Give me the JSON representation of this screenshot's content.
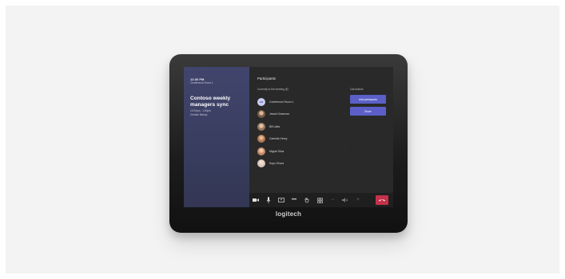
{
  "meeting": {
    "time": "12:30 PM",
    "room": "Conference Room 1",
    "title": "Contoso weekly managers sync",
    "time_range": "12:00pm - 1:00pm",
    "organizer": "Christie Bishop"
  },
  "participants_panel": {
    "title": "Participants",
    "subheading": "Currently in the meeting (6)",
    "call_actions_label": "Call actions",
    "primary_action": "Add participants",
    "secondary_action": "Share",
    "items": [
      {
        "name": "Conference Room 1",
        "initials": "CR",
        "color": "#c9ccf0",
        "avatar_type": "initials",
        "muted": false
      },
      {
        "name": "Jessie Dinsmore",
        "color": "#7a5a47",
        "avatar_type": "photo",
        "muted": true
      },
      {
        "name": "Bill Latta",
        "color": "#9a7a60",
        "avatar_type": "photo",
        "muted": false
      },
      {
        "name": "Camelia Henry",
        "color": "#b07a52",
        "avatar_type": "photo",
        "muted": false
      },
      {
        "name": "Miguel Silva",
        "color": "#c48a6a",
        "avatar_type": "photo",
        "muted": true
      },
      {
        "name": "Kayo Ohara",
        "color": "#d9c7bc",
        "avatar_type": "photo",
        "muted": false
      }
    ]
  },
  "toolbar": {
    "icons": [
      "camera-icon",
      "microphone-icon",
      "share-screen-icon",
      "more-options-icon",
      "raise-hand-icon",
      "layout-icon",
      "volume-down-icon",
      "volume-mute-icon",
      "volume-up-icon"
    ],
    "end_call_color": "#c4314b"
  },
  "brand": {
    "logo": "logitech"
  },
  "colors": {
    "accent": "#5b5fc7",
    "panel": "#292929",
    "sidebar": "#3a3d63"
  }
}
